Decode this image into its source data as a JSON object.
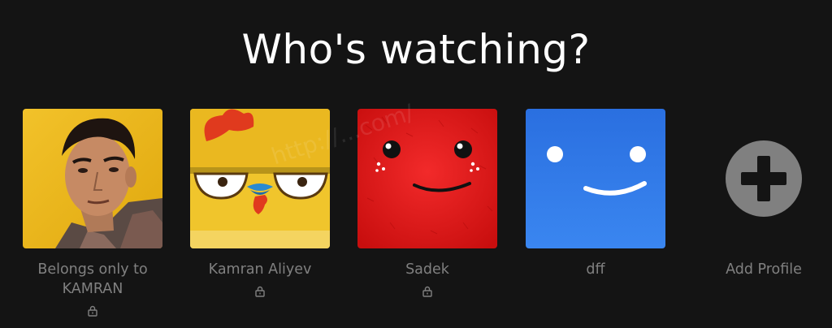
{
  "page": {
    "title": "Who's watching?"
  },
  "profiles": [
    {
      "name": "Belongs only to\nKAMRAN",
      "locked": true,
      "avatar_icon": "person-photo-icon",
      "color": "#e8b818"
    },
    {
      "name": "Kamran Aliyev",
      "locked": true,
      "avatar_icon": "chicken-face-icon",
      "color": "#f0c830"
    },
    {
      "name": "Sadek",
      "locked": true,
      "avatar_icon": "red-fuzzy-face-icon",
      "color": "#e01818"
    },
    {
      "name": "dff",
      "locked": false,
      "avatar_icon": "blue-smiley-icon",
      "color": "#2d7ae8"
    }
  ],
  "add_profile": {
    "label": "Add Profile",
    "icon": "plus-icon",
    "color": "#808080"
  },
  "watermark": "http://...com/"
}
